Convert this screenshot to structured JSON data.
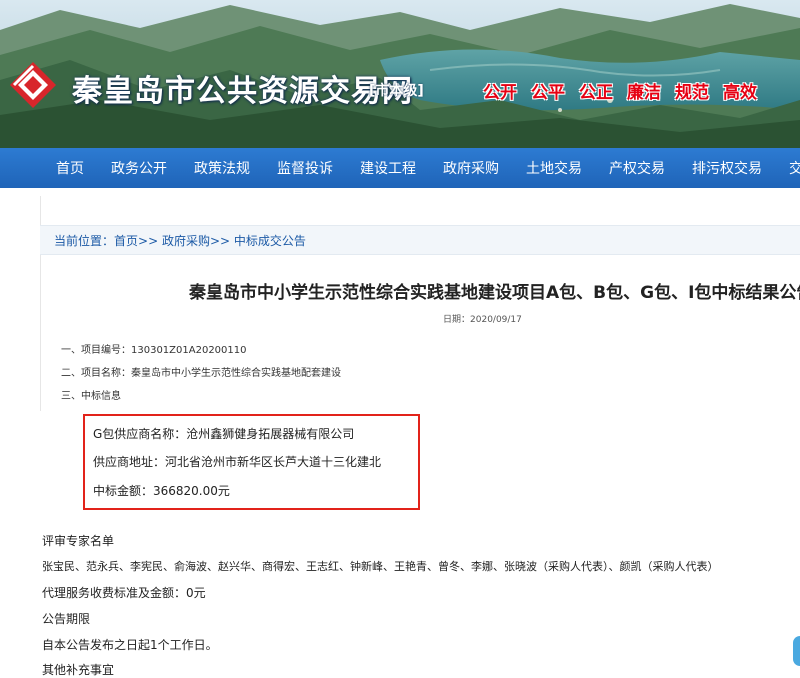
{
  "site": {
    "title": "秦皇岛市公共资源交易网",
    "subtitle": "[市本级]",
    "slogans": [
      "公开",
      "公平",
      "公正",
      "廉洁",
      "规范",
      "高效"
    ]
  },
  "nav": {
    "items": [
      "首页",
      "政务公开",
      "政策法规",
      "监督投诉",
      "建设工程",
      "政府采购",
      "土地交易",
      "产权交易",
      "排污权交易",
      "交易"
    ]
  },
  "breadcrumb": {
    "prefix": "当前位置：",
    "home": "首页",
    "sep1": ">>",
    "level1": "政府采购",
    "sep2": ">>",
    "level2": "中标成交公告"
  },
  "article": {
    "title": "秦皇岛市中小学生示范性综合实践基地建设项目A包、B包、G包、I包中标结果公告",
    "date_label": "日期：",
    "date": "2020/09/17",
    "items": [
      "一、项目编号：130301Z01A20200110",
      "二、项目名称：秦皇岛市中小学生示范性综合实践基地配套建设",
      "三、中标信息"
    ],
    "winner": {
      "supplier_name": "G包供应商名称：沧州鑫狮健身拓展器械有限公司",
      "supplier_address": "供应商地址：河北省沧州市新华区长芦大道十三化建北",
      "bid_amount": "中标金额：366820.00元"
    },
    "experts_heading": "评审专家名单",
    "experts": "张宝民、范永兵、李宪民、俞海波、赵兴华、商得宏、王志红、钟新峰、王艳青、曾冬、李娜、张晓波（采购人代表）、颜凯（采购人代表）",
    "agency_fee": "代理服务收费标准及金额：0元",
    "period_heading": "公告期限",
    "period_text": "自本公告发布之日起1个工作日。",
    "other_heading": "其他补充事宜"
  },
  "colors": {
    "nav_bg": "#2365bb",
    "slogan": "#e60012",
    "highlight_border": "#e2231a",
    "breadcrumb": "#1c5aa6"
  }
}
